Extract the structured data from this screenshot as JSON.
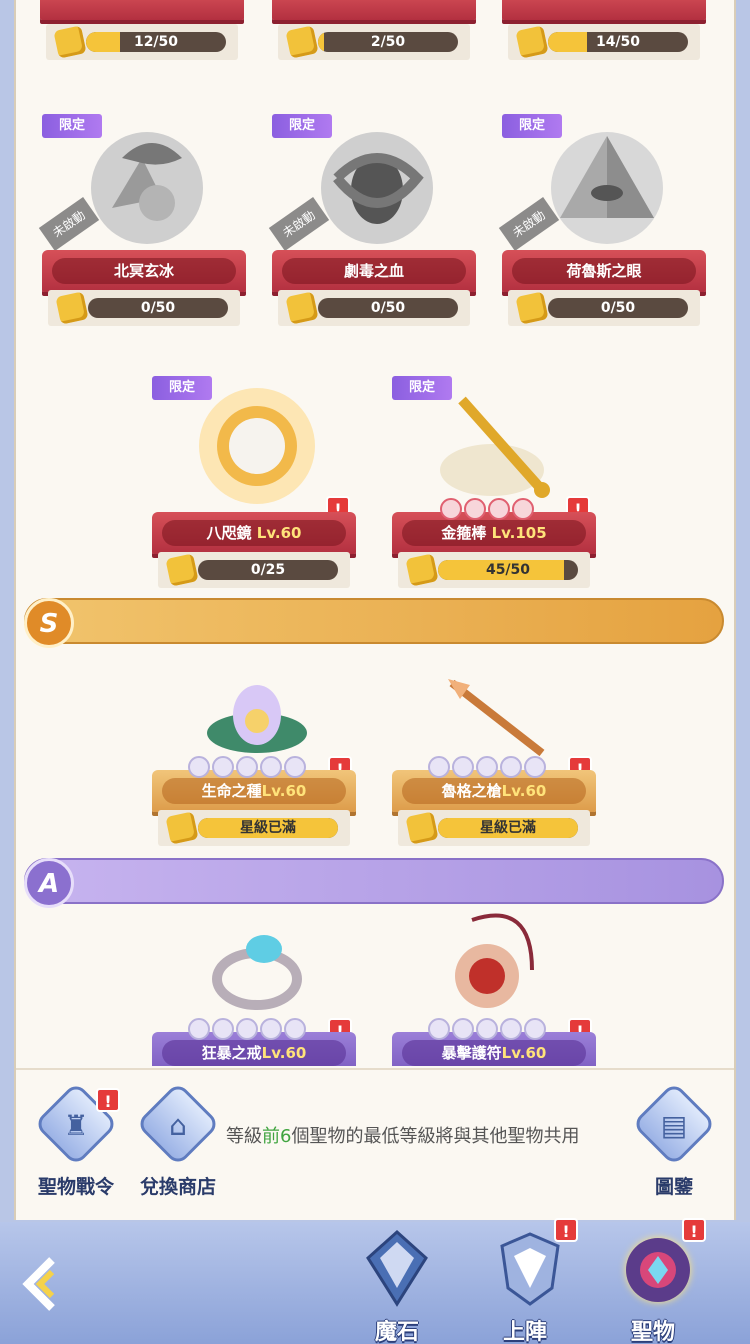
{
  "top_progress": [
    {
      "text": "12/50",
      "fraction": 0.24
    },
    {
      "text": "2/50",
      "fraction": 0.04
    },
    {
      "text": "14/50",
      "fraction": 0.28
    }
  ],
  "locked_items": [
    {
      "name": "北冥玄冰",
      "badge": "限定",
      "status": "未啟動",
      "progress": "0/50",
      "fraction": 0
    },
    {
      "name": "劇毒之血",
      "badge": "限定",
      "status": "未啟動",
      "progress": "0/50",
      "fraction": 0
    },
    {
      "name": "荷魯斯之眼",
      "badge": "限定",
      "status": "未啟動",
      "progress": "0/50",
      "fraction": 0
    }
  ],
  "limited_items": [
    {
      "name": "八咫鏡",
      "level": "Lv.60",
      "badge": "限定",
      "progress": "0/25",
      "fraction": 0,
      "alert": "!"
    },
    {
      "name": "金箍棒",
      "level": "Lv.105",
      "badge": "限定",
      "progress": "45/50",
      "fraction": 0.9,
      "alert": "!"
    }
  ],
  "tiers": {
    "s": "S",
    "a": "A"
  },
  "s_items": [
    {
      "name": "生命之種",
      "level": "Lv.60",
      "status": "星級已滿",
      "alert": "!"
    },
    {
      "name": "魯格之槍",
      "level": "Lv.60",
      "status": "星級已滿",
      "alert": "!"
    }
  ],
  "a_items": [
    {
      "name": "狂暴之戒",
      "level": "Lv.60",
      "alert": "!"
    },
    {
      "name": "暴擊護符",
      "level": "Lv.60",
      "alert": "!"
    }
  ],
  "bottom": {
    "battle_pass": "聖物戰令",
    "shop": "兌換商店",
    "codex": "圖鑒",
    "alert": "!",
    "notice_pre": "等級",
    "notice_hl": "前6",
    "notice_post": "個聖物的最低等級將與其他聖物共用"
  },
  "footer": {
    "tabs": [
      {
        "label": "魔石",
        "icon": "gem-icon"
      },
      {
        "label": "上陣",
        "icon": "shield-wings-icon",
        "alert": "!"
      },
      {
        "label": "聖物",
        "icon": "relic-icon",
        "alert": "!"
      }
    ]
  },
  "colors": {
    "accent_gold": "#f5c43a",
    "alert_red": "#e53a3a",
    "tier_s": "#e5a240",
    "tier_a": "#a792e0"
  }
}
